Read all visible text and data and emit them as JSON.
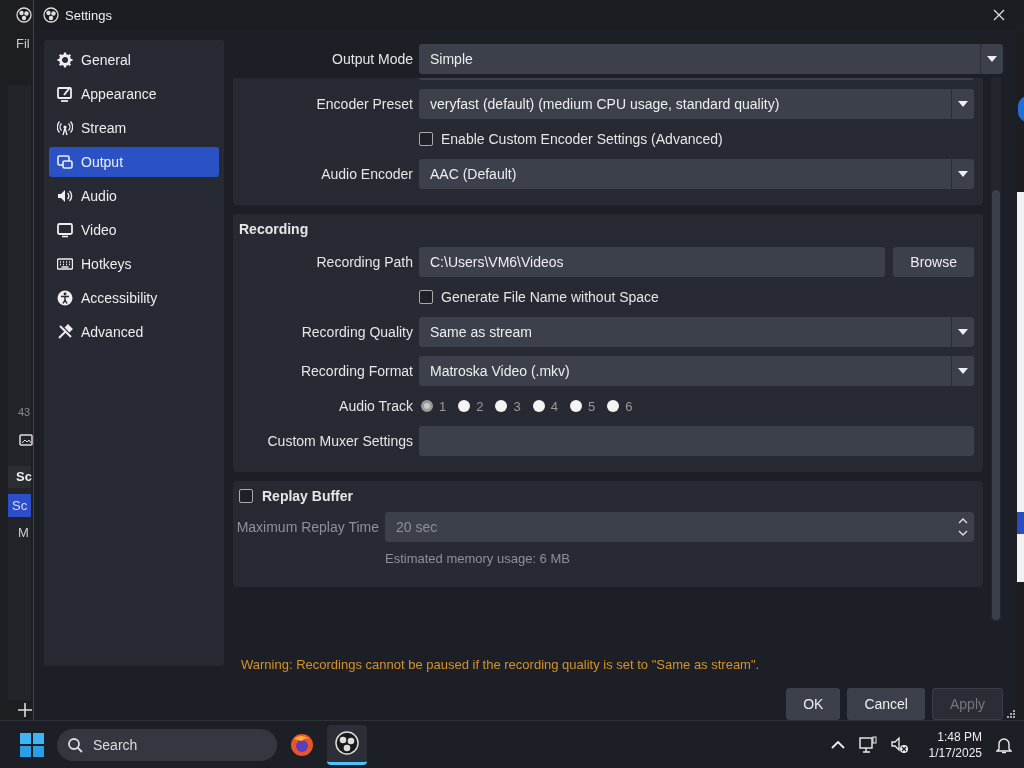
{
  "background_app": {
    "menu_text": "Fil",
    "fragments": [
      {
        "kind": "count",
        "text": "43"
      },
      {
        "kind": "header",
        "text": "Sc"
      },
      {
        "kind": "selected",
        "text": "Sc"
      },
      {
        "kind": "plain",
        "text": "M"
      }
    ]
  },
  "window": {
    "title": "Settings"
  },
  "sidebar": {
    "items": [
      {
        "label": "General",
        "selected": false
      },
      {
        "label": "Appearance",
        "selected": false
      },
      {
        "label": "Stream",
        "selected": false
      },
      {
        "label": "Output",
        "selected": true
      },
      {
        "label": "Audio",
        "selected": false
      },
      {
        "label": "Video",
        "selected": false
      },
      {
        "label": "Hotkeys",
        "selected": false
      },
      {
        "label": "Accessibility",
        "selected": false
      },
      {
        "label": "Advanced",
        "selected": false
      }
    ]
  },
  "output_mode": {
    "label": "Output Mode",
    "value": "Simple"
  },
  "streaming": {
    "rows": [
      {
        "kind": "select",
        "label": "Encoder Preset",
        "value": "veryfast (default) (medium CPU usage, standard quality)"
      },
      {
        "kind": "checkbox",
        "label": "Enable Custom Encoder Settings (Advanced)",
        "checked": false
      },
      {
        "kind": "select",
        "label": "Audio Encoder",
        "value": "AAC (Default)"
      }
    ]
  },
  "recording": {
    "title": "Recording",
    "rows": [
      {
        "kind": "path",
        "label": "Recording Path",
        "value": "C:\\Users\\VM6\\Videos",
        "button": "Browse"
      },
      {
        "kind": "checkbox",
        "label": "Generate File Name without Space",
        "checked": false
      },
      {
        "kind": "select",
        "label": "Recording Quality",
        "value": "Same as stream"
      },
      {
        "kind": "select",
        "label": "Recording Format",
        "value": "Matroska Video (.mkv)"
      },
      {
        "kind": "radios",
        "label": "Audio Track",
        "options": [
          {
            "label": "1",
            "selected": true
          },
          {
            "label": "2",
            "selected": false
          },
          {
            "label": "3",
            "selected": false
          },
          {
            "label": "4",
            "selected": false
          },
          {
            "label": "5",
            "selected": false
          },
          {
            "label": "6",
            "selected": false
          }
        ]
      },
      {
        "kind": "text",
        "label": "Custom Muxer Settings"
      }
    ]
  },
  "replay_buffer": {
    "title": "Replay Buffer",
    "checked": false,
    "time_label": "Maximum Replay Time",
    "time_value": "20 sec",
    "memory": "Estimated memory usage: 6 MB"
  },
  "warning": "Warning: Recordings cannot be paused if the recording quality is set to \"Same as stream\".",
  "buttons": [
    {
      "label": "OK",
      "disabled": false
    },
    {
      "label": "Cancel",
      "disabled": false
    },
    {
      "label": "Apply",
      "disabled": true
    }
  ],
  "taskbar": {
    "search_placeholder": "Search",
    "time": "1:48 PM",
    "date": "1/17/2025"
  }
}
